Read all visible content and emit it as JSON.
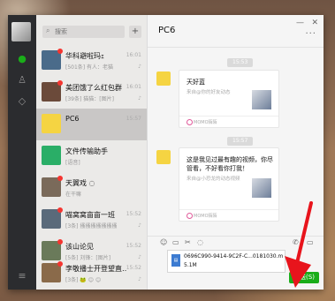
{
  "search": {
    "placeholder": "搜索"
  },
  "list": {
    "items": [
      {
        "name": "华科避啦玛ｪ",
        "preview": "[501条] 有人：老猫",
        "time": "16:01",
        "badge": true,
        "muted": true,
        "color": "#4a6b8a"
      },
      {
        "name": "美团饿了么红包群",
        "preview": "[39条] 猫猫：[图片]",
        "time": "16:01",
        "badge": true,
        "muted": true,
        "color": "#6b4a3a"
      },
      {
        "name": "PC6",
        "preview": "",
        "time": "15:57",
        "badge": false,
        "muted": false,
        "color": "#f5d442",
        "selected": true
      },
      {
        "name": "文件传输助手",
        "preview": "[语音]",
        "time": "",
        "badge": false,
        "muted": false,
        "color": "#2aae67"
      },
      {
        "name": "天翼戏 ◌",
        "preview": "在干嘛",
        "time": "",
        "badge": true,
        "muted": false,
        "color": "#7a6a5a"
      },
      {
        "name": "喵窝窝亩亩一班",
        "preview": "[3条] 搔搔搔搔搔搔搔",
        "time": "15:52",
        "badge": true,
        "muted": true,
        "color": "#5a6a7a"
      },
      {
        "name": "该山论见",
        "preview": "[5条] 刘锋：[图片]",
        "time": "15:52",
        "badge": true,
        "muted": true,
        "color": "#6a7a5a"
      },
      {
        "name": "李敬播士开登望直…",
        "preview": "[3条] 🐸 😊 😊",
        "time": "15:52",
        "badge": true,
        "muted": true,
        "color": "#8a6a4a"
      }
    ]
  },
  "chat": {
    "title": "PC6",
    "more": "···",
    "win_min": "—",
    "win_close": "✕",
    "messages": [
      {
        "time": "15:53",
        "title": "天好蓝",
        "desc": "来自@你的好友动态",
        "source": "MOMO陌陌"
      },
      {
        "time": "15:57",
        "title": "这是我见过最有趣的视频，你尽管看，不好看你打我！",
        "desc": "来自@小恐龙的动态视频",
        "source": "MOMO陌陌"
      }
    ],
    "tools": [
      "☺",
      "▭",
      "✂",
      "◌",
      "✆",
      "▭"
    ],
    "file": {
      "name": "0696C990-9414-9C2F-C...0181030.mp4",
      "size": "5.1M"
    },
    "send_label": "发送(S)"
  },
  "colors": {
    "accent": "#1aad19",
    "badge": "#f43530"
  }
}
